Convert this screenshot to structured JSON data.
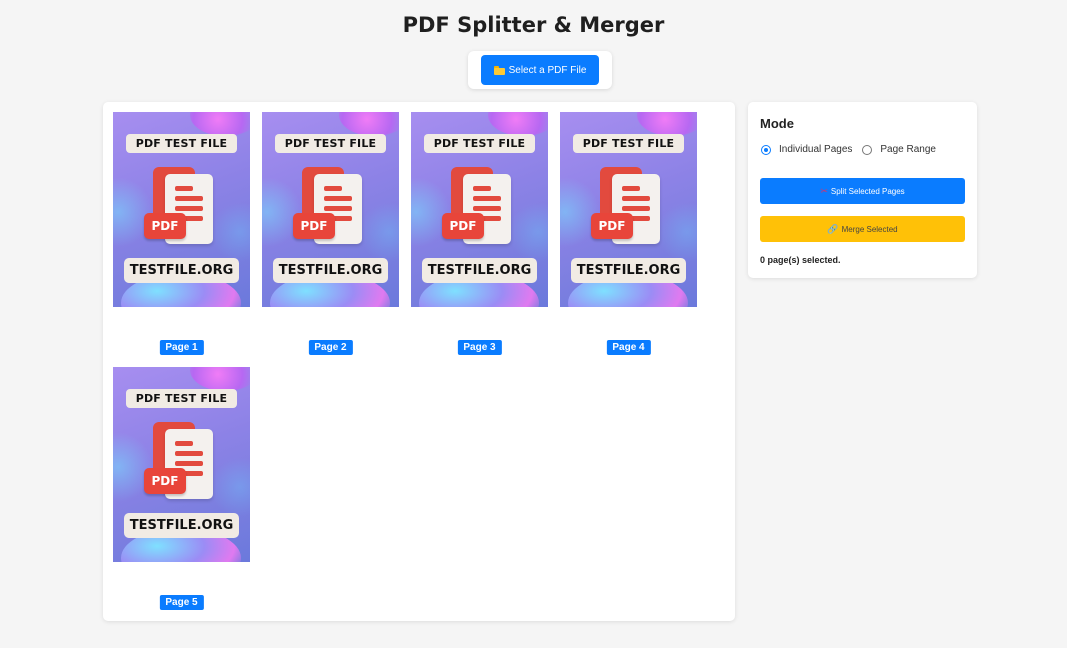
{
  "app": {
    "title": "PDF Splitter & Merger"
  },
  "toolbar": {
    "select_label": "Select a PDF File",
    "select_icon": "folder-icon"
  },
  "thumbnail": {
    "top_label": "PDF TEST FILE",
    "badge": "PDF",
    "bottom_label": "TESTFILE.ORG"
  },
  "pages": [
    {
      "label": "Page 1"
    },
    {
      "label": "Page 2"
    },
    {
      "label": "Page 3"
    },
    {
      "label": "Page 4"
    },
    {
      "label": "Page 5"
    }
  ],
  "sidebar": {
    "heading": "Mode",
    "modes": [
      {
        "label": "Individual Pages",
        "checked": true
      },
      {
        "label": "Page Range",
        "checked": false
      }
    ],
    "split_label": "Split Selected Pages",
    "split_icon": "scissors-icon",
    "merge_label": "Merge Selected",
    "merge_icon": "link-icon",
    "selected_text": "0 page(s) selected."
  },
  "colors": {
    "primary": "#0a7cff",
    "warning": "#ffc107",
    "background": "#f5f5f5"
  }
}
